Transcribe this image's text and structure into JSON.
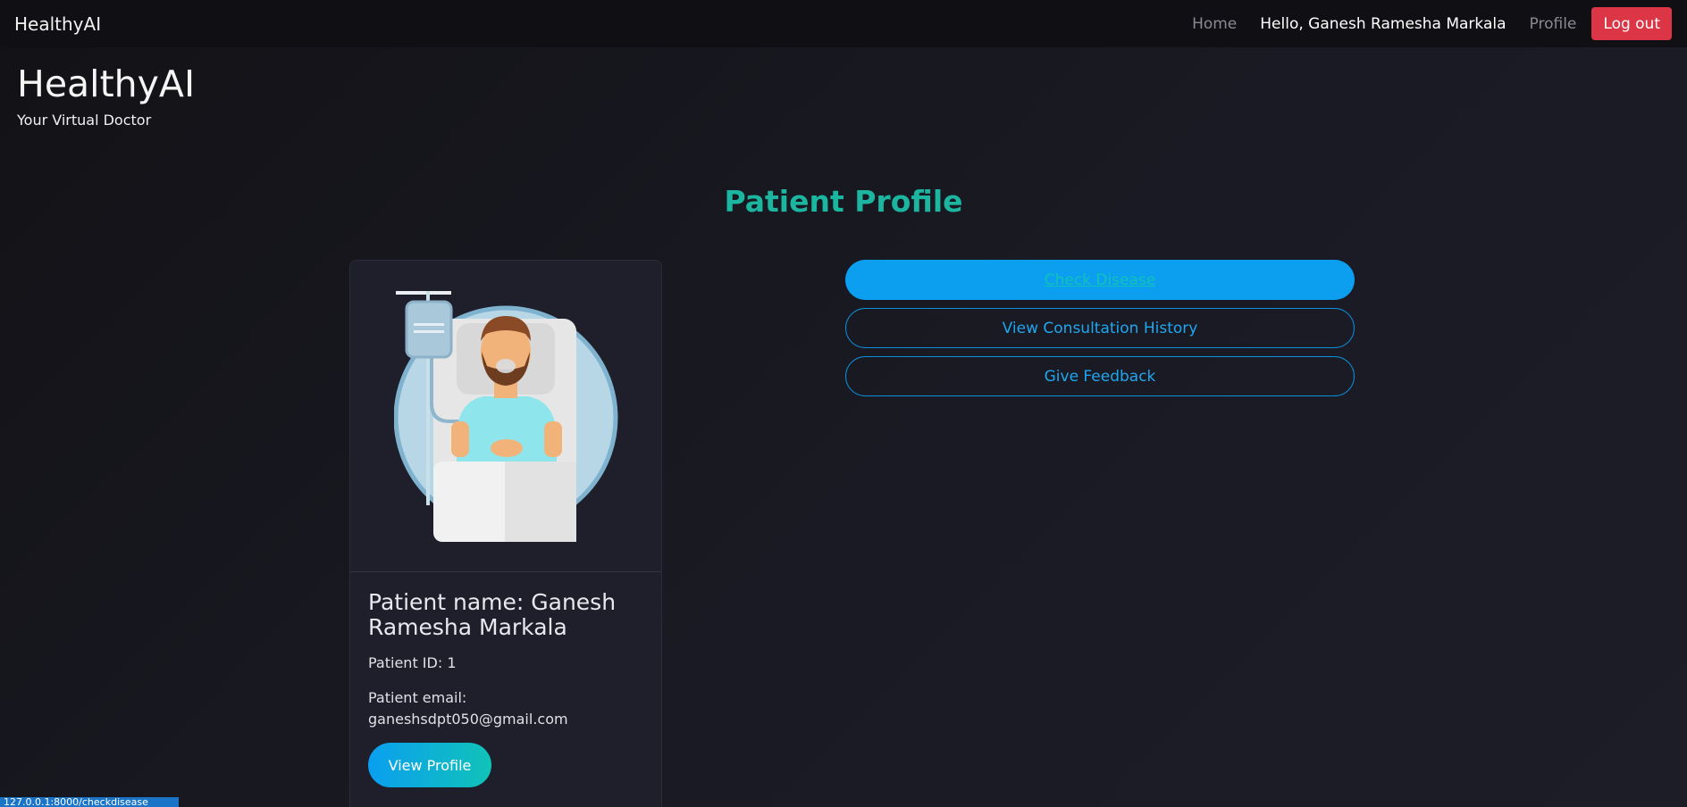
{
  "navbar": {
    "brand": "HealthyAI",
    "home": "Home",
    "hello": "Hello, Ganesh Ramesha Markala",
    "profile": "Profile",
    "logout": "Log out"
  },
  "header": {
    "title": "HealthyAI",
    "subtitle": "Your Virtual Doctor"
  },
  "page": {
    "title": "Patient Profile"
  },
  "card": {
    "image_icon": "patient-in-bed-illustration",
    "name": "Patient name: Ganesh Ramesha Markala",
    "id": "Patient ID: 1",
    "email_label": "Patient email:",
    "email": "ganeshsdpt050@gmail.com",
    "view_profile": "View Profile"
  },
  "actions": {
    "check_disease": "Check Disease",
    "history": "View Consultation History",
    "feedback": "Give Feedback"
  },
  "statusbar": {
    "url": "127.0.0.1:8000/checkdisease"
  },
  "colors": {
    "accent": "#1bb5a0",
    "primary_button": "#0c9ff0",
    "logout": "#dc3545"
  }
}
